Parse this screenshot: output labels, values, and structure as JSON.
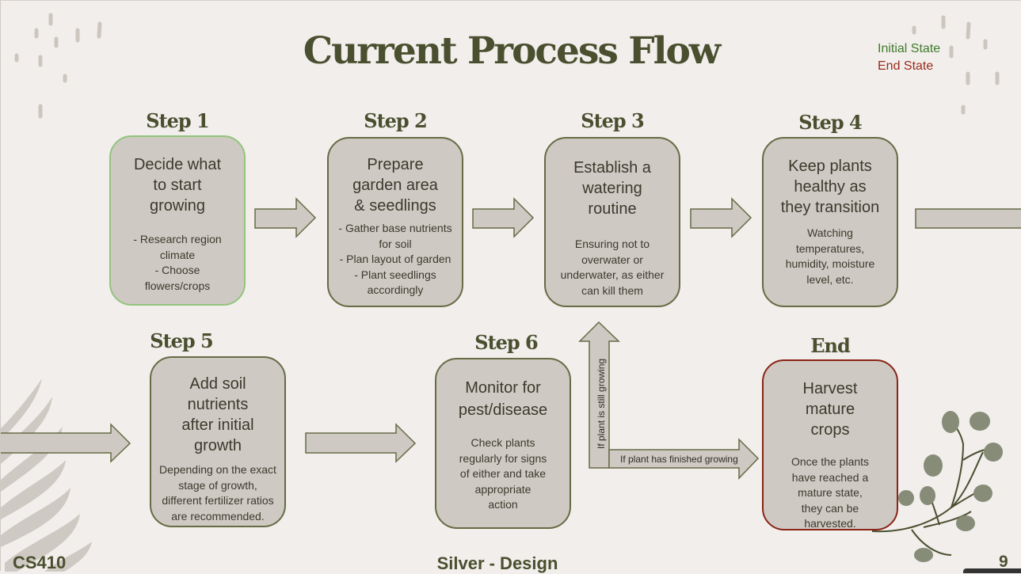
{
  "slide": {
    "title": "Current Process Flow",
    "legend": {
      "initial": "Initial State",
      "end": "End State"
    },
    "steps": [
      {
        "label": "Step 1",
        "title": "Decide what to start growing",
        "title_lines": [
          "Decide what",
          "to start",
          "growing"
        ],
        "desc": "- Research region climate\n- Choose flowers/crops",
        "desc_lines": [
          "- Research region",
          "climate",
          "- Choose",
          "flowers/crops"
        ],
        "state": "initial"
      },
      {
        "label": "Step 2",
        "title": "Prepare garden area & seedlings",
        "title_lines": [
          "Prepare",
          "garden area",
          "& seedlings"
        ],
        "desc_lines": [
          "- Gather base nutrients",
          "for soil",
          "- Plan layout of garden",
          "- Plant seedlings",
          "accordingly"
        ]
      },
      {
        "label": "Step 3",
        "title": "Establish a watering routine",
        "title_lines": [
          "Establish a",
          "watering",
          "routine"
        ],
        "desc_lines": [
          "Ensuring not to",
          "overwater or",
          "underwater, as either",
          "can kill them"
        ]
      },
      {
        "label": "Step 4",
        "title": "Keep plants healthy as they transition",
        "title_lines": [
          "Keep plants",
          "healthy as",
          "they transition"
        ],
        "desc_lines": [
          "Watching",
          "temperatures,",
          "humidity, moisture",
          "level, etc."
        ]
      },
      {
        "label": "Step 5",
        "title": "Add soil nutrients after initial growth",
        "title_lines": [
          "Add soil",
          "nutrients",
          "after initial",
          "growth"
        ],
        "desc_lines": [
          "Depending on the exact",
          "stage of growth,",
          "different fertilizer ratios",
          "are recommended."
        ]
      },
      {
        "label": "Step 6",
        "title": "Monitor for pest/disease",
        "title_lines": [
          "Monitor for",
          "pest/disease"
        ],
        "desc_lines": [
          "Check plants",
          "regularly for signs",
          "of either and take",
          "appropriate",
          "action"
        ]
      },
      {
        "label": "End",
        "title": "Harvest mature crops",
        "title_lines": [
          "Harvest",
          "mature",
          "crops"
        ],
        "desc_lines": [
          "Once the plants",
          "have reached a",
          "mature state,",
          "they can be",
          "harvested."
        ],
        "state": "end"
      }
    ],
    "conditions": {
      "still_growing": "If plant is still growing",
      "finished_growing": "If plant has finished growing"
    },
    "footer": {
      "course": "CS410",
      "team": "Silver - Design",
      "page_number": "9"
    },
    "colors": {
      "title": "#4a4f2f",
      "box_fill": "#cfc9c3",
      "box_border": "#666b44",
      "initial_border": "#93c47d",
      "end_border": "#8a2416",
      "initial_text": "#3f7a2d",
      "end_text": "#9b2a1b"
    }
  }
}
